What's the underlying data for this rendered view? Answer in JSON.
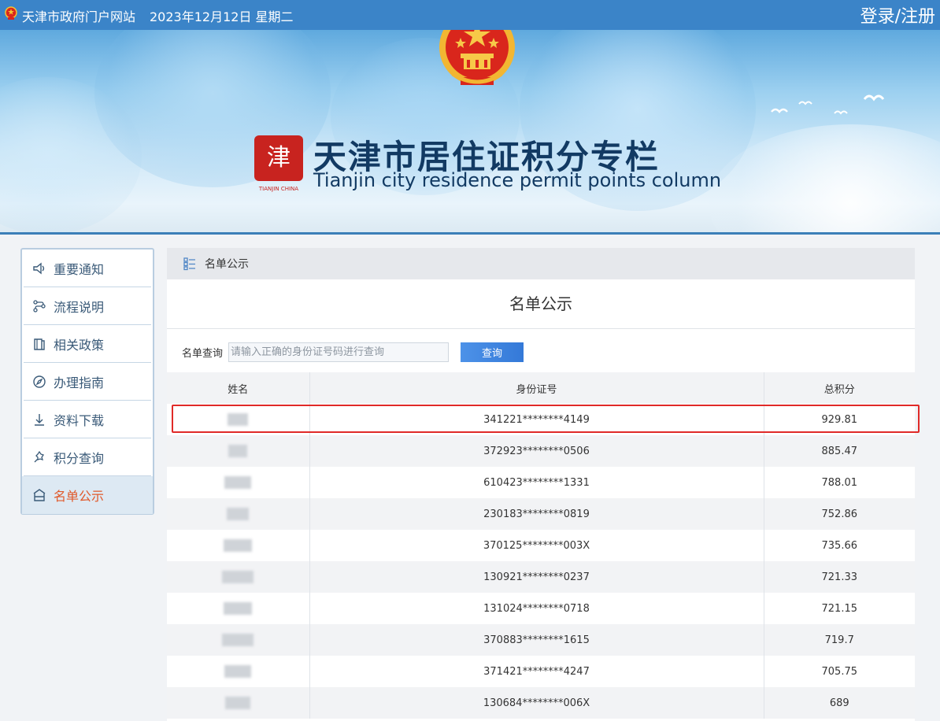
{
  "topbar": {
    "site_name": "天津市政府门户网站",
    "date": "2023年12月12日 星期二",
    "login": "登录/注册"
  },
  "banner": {
    "title_cn": "天津市居住证积分专栏",
    "title_en": "Tianjin city residence permit points column",
    "seal_caption": "TIANJIN CHINA"
  },
  "sidebar": {
    "items": [
      {
        "label": "重要通知",
        "icon": "speaker-icon"
      },
      {
        "label": "流程说明",
        "icon": "flow-icon"
      },
      {
        "label": "相关政策",
        "icon": "book-icon"
      },
      {
        "label": "办理指南",
        "icon": "compass-icon"
      },
      {
        "label": "资料下载",
        "icon": "download-icon"
      },
      {
        "label": "积分查询",
        "icon": "query-icon"
      },
      {
        "label": "名单公示",
        "icon": "building-icon",
        "active": true
      }
    ]
  },
  "main": {
    "breadcrumb": "名单公示",
    "title": "名单公示",
    "search": {
      "label": "名单查询",
      "placeholder": "请输入正确的身份证号码进行查询",
      "button": "查询"
    },
    "table": {
      "headers": [
        "姓名",
        "身份证号",
        "总积分"
      ],
      "rows": [
        {
          "id": "341221********4149",
          "score": "929.81"
        },
        {
          "id": "372923********0506",
          "score": "885.47"
        },
        {
          "id": "610423********1331",
          "score": "788.01"
        },
        {
          "id": "230183********0819",
          "score": "752.86"
        },
        {
          "id": "370125********003X",
          "score": "735.66"
        },
        {
          "id": "130921********0237",
          "score": "721.33"
        },
        {
          "id": "131024********0718",
          "score": "721.15"
        },
        {
          "id": "370883********1615",
          "score": "719.7"
        },
        {
          "id": "371421********4247",
          "score": "705.75"
        },
        {
          "id": "130684********006X",
          "score": "689"
        }
      ]
    }
  },
  "colors": {
    "topbar": "#3b84c8",
    "active_item": "#e0592a",
    "button": "#3479d8",
    "highlight": "#e02a28"
  }
}
